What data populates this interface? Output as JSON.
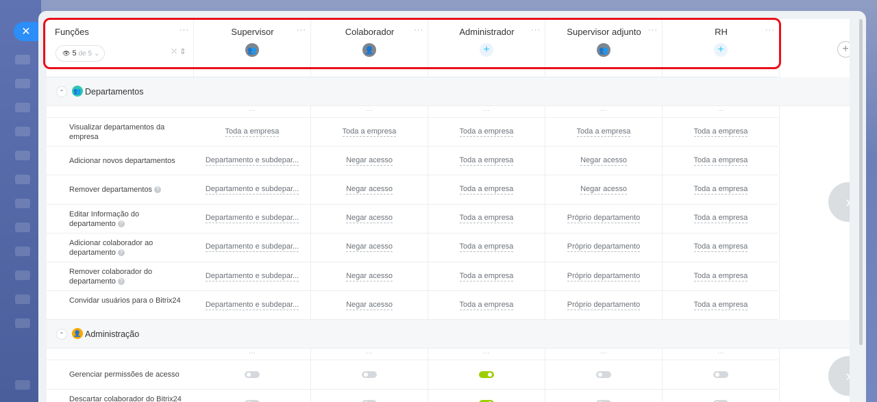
{
  "header": {
    "first_col_title": "Funções",
    "pill": {
      "count": "5",
      "of_text": "de 5"
    },
    "roles": [
      {
        "name": "Supervisor",
        "icon": "group-avatar-icon"
      },
      {
        "name": "Colaborador",
        "icon": "user-avatar-icon"
      },
      {
        "name": "Administrador",
        "icon": "plus-icon"
      },
      {
        "name": "Supervisor adjunto",
        "icon": "group-avatar-icon"
      },
      {
        "name": "RH",
        "icon": "plus-icon"
      }
    ],
    "dots": "···"
  },
  "sections": [
    {
      "title": "Departamentos",
      "icon_color": "#2fc6b4",
      "rows": [
        {
          "label": "Visualizar departamentos da empresa",
          "values": [
            "Toda a empresa",
            "Toda a empresa",
            "Toda a empresa",
            "Toda a empresa",
            "Toda a empresa"
          ]
        },
        {
          "label": "Adicionar novos departamentos",
          "values": [
            "Departamento e subdepar...",
            "Negar acesso",
            "Toda a empresa",
            "Negar acesso",
            "Toda a empresa"
          ]
        },
        {
          "label": "Remover departamentos",
          "values": [
            "Departamento e subdepar...",
            "Negar acesso",
            "Toda a empresa",
            "Negar acesso",
            "Toda a empresa"
          ]
        },
        {
          "label": "Editar Informação do departamento",
          "values": [
            "Departamento e subdepar...",
            "Negar acesso",
            "Toda a empresa",
            "Próprio departamento",
            "Toda a empresa"
          ]
        },
        {
          "label": "Adicionar colaborador ao departamento",
          "values": [
            "Departamento e subdepar...",
            "Negar acesso",
            "Toda a empresa",
            "Próprio departamento",
            "Toda a empresa"
          ]
        },
        {
          "label": "Remover colaborador do departamento",
          "values": [
            "Departamento e subdepar...",
            "Negar acesso",
            "Toda a empresa",
            "Próprio departamento",
            "Toda a empresa"
          ]
        },
        {
          "label": "Convidar usuários para o Bitrix24",
          "values": [
            "Departamento e subdepar...",
            "Negar acesso",
            "Toda a empresa",
            "Próprio departamento",
            "Toda a empresa"
          ]
        }
      ]
    },
    {
      "title": "Administração",
      "icon_color": "#f7a700",
      "rows": [
        {
          "label": "Gerenciar permissões de acesso",
          "toggles": [
            false,
            false,
            true,
            false,
            false
          ]
        },
        {
          "label": "Descartar colaborador do Bitrix24",
          "toggles": [
            false,
            false,
            true,
            false,
            false
          ]
        }
      ]
    }
  ]
}
